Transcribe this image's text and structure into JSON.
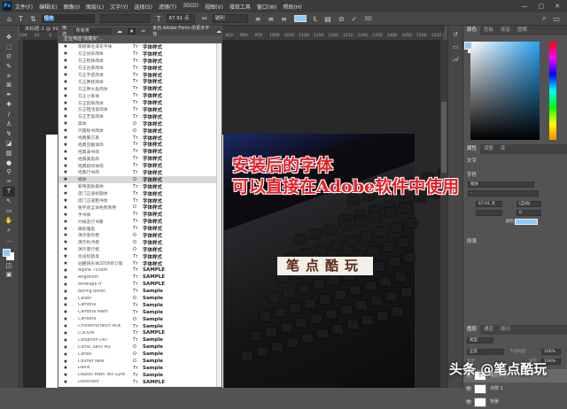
{
  "app": {
    "logo": "Ps",
    "menu": [
      "文件(F)",
      "编辑(E)",
      "图像(I)",
      "图层(L)",
      "文字(Y)",
      "选择(S)",
      "滤镜(T)",
      "3D(D)",
      "视图(V)",
      "增效工具",
      "窗口(W)",
      "帮助(H)"
    ],
    "window_controls": [
      "—",
      "▢",
      "✕"
    ]
  },
  "options": {
    "font_family": "楷体",
    "font_style": "",
    "size": "67.91 点",
    "antialias_icon": "aa",
    "antialias": "锐利",
    "color": "#8ccbf7"
  },
  "document": {
    "tab": "未标题-1 @ 99.2% (笔点酷玩, RGB/8) *",
    "ruler": [
      "100",
      "50",
      "0",
      "",
      "",
      "",
      "",
      "",
      "",
      "",
      "",
      "",
      "750",
      "800",
      "850",
      "900",
      "950",
      "1000",
      "1050",
      "1100",
      "1150",
      "1200",
      "1250",
      "1300",
      "1350",
      "1400",
      "1450",
      "1500",
      "1550"
    ]
  },
  "font_dropdown": {
    "filter_label": "筛选:",
    "filter_value": "所有类",
    "more_label": "来自 Adobe Fonts 的更多字体:",
    "filtering_text": "正在筛选\"收藏夹\"...",
    "fonts": [
      {
        "name": "草檀斋毛泽东字体",
        "type": "Tт",
        "sample": "字体样式"
      },
      {
        "name": "方正仿宋简体",
        "type": "Tт",
        "sample": "字体样式"
      },
      {
        "name": "方正楷体简体",
        "type": "Tт",
        "sample": "字体样式"
      },
      {
        "name": "方正古隶简体",
        "type": "Tт",
        "sample": "字体样式"
      },
      {
        "name": "方正字迹简体",
        "type": "Tт",
        "sample": "字体样式"
      },
      {
        "name": "方正胖娃简体",
        "type": "Tт",
        "sample": "字体样式"
      },
      {
        "name": "方正胖头鱼简体",
        "type": "Tт",
        "sample": "字体样式"
      },
      {
        "name": "方正小篆体",
        "type": "Tт",
        "sample": "字体样式"
      },
      {
        "name": "方正剪纸简体",
        "type": "Tт",
        "sample": "字体样式"
      },
      {
        "name": "方正粗活意简体",
        "type": "Tт",
        "sample": "字体样式"
      },
      {
        "name": "方正艺黑简体",
        "type": "Tт",
        "sample": "字体样式"
      },
      {
        "name": "黑体",
        "type": "O",
        "sample": "字体样式"
      },
      {
        "name": "鸿雷板书简体",
        "type": "O",
        "sample": "字体样式"
      },
      {
        "name": "经典繁方篆",
        "type": "Tт",
        "sample": "字体样式"
      },
      {
        "name": "经典空趣体简",
        "type": "Tт",
        "sample": "字体样式"
      },
      {
        "name": "经典隶书简",
        "type": "Tт",
        "sample": "字体样式"
      },
      {
        "name": "经典美黑简",
        "type": "Tт",
        "sample": "字体样式"
      },
      {
        "name": "经典舒同体简",
        "type": "Tт",
        "sample": "字体样式"
      },
      {
        "name": "经典行书简",
        "type": "Tт",
        "sample": "字体样式"
      },
      {
        "name": "楷体",
        "type": "O",
        "sample": "字体样式",
        "selected": true
      },
      {
        "name": "新蒂黑板报体",
        "type": "Tт",
        "sample": "字体样式"
      },
      {
        "name": "庞门正道标题体",
        "type": "Tт",
        "sample": "字体样式"
      },
      {
        "name": "庞门正道粗书体",
        "type": "Tт",
        "sample": "字体样式"
      },
      {
        "name": "锐字真言体免费商用",
        "type": "O",
        "sample": "字体样式"
      },
      {
        "name": "手书体",
        "type": "Tт",
        "sample": "字体样式"
      },
      {
        "name": "叶根友行书繁",
        "type": "Tт",
        "sample": "字体样式"
      },
      {
        "name": "微软雅黑",
        "type": "Tт",
        "sample": "字体样式",
        "group": true
      },
      {
        "name": "演示春风楷",
        "type": "O",
        "sample": "字体样式"
      },
      {
        "name": "演示秋鸿楷",
        "type": "O",
        "sample": "字体样式"
      },
      {
        "name": "演示夏行楷",
        "type": "O",
        "sample": "字体样式"
      },
      {
        "name": "优设标题黑",
        "type": "Tт",
        "sample": "字体样式"
      },
      {
        "name": "站酷快乐体2016修订版",
        "type": "Tт",
        "sample": "字体样式"
      },
      {
        "name": "Alpine 7558M",
        "type": "Tт",
        "sample": "SAMPLE"
      },
      {
        "name": "Angstrom",
        "type": "Tт",
        "sample": "SAMPLE"
      },
      {
        "name": "Antelope H",
        "type": "Tт",
        "sample": "SAMPLE"
      },
      {
        "name": "Boring Boron",
        "type": "Tт",
        "sample": "Sample"
      },
      {
        "name": "Calibri",
        "type": "O",
        "sample": "Sample",
        "group": true
      },
      {
        "name": "Cambria",
        "type": "Tт",
        "sample": "Sample",
        "group": true
      },
      {
        "name": "Cambria Math",
        "type": "Tт",
        "sample": "Sample"
      },
      {
        "name": "Candara",
        "type": "O",
        "sample": "Sample",
        "group": true
      },
      {
        "name": "ChickenScratch AOE",
        "type": "Tт",
        "sample": "Sample"
      },
      {
        "name": "CODON",
        "type": "Tт",
        "sample": "SAMPLE"
      },
      {
        "name": "Colophon DRT",
        "type": "Tт",
        "sample": "Sample"
      },
      {
        "name": "Comic Sans MS",
        "type": "O",
        "sample": "Sample",
        "group": true
      },
      {
        "name": "Corbel",
        "type": "O",
        "sample": "Sample",
        "group": true
      },
      {
        "name": "Courier New",
        "type": "O",
        "sample": "Sample",
        "group": true
      },
      {
        "name": "Davis",
        "type": "Tт",
        "sample": "Sample"
      },
      {
        "name": "DejaVu Math TeX Gyre",
        "type": "Tт",
        "sample": "Sample"
      },
      {
        "name": "Dissonant",
        "type": "Tт",
        "sample": "SAMPLE"
      }
    ]
  },
  "canvas": {
    "overlay_line1": "安装后的字体",
    "overlay_line2": "可以直接在Adobe软件中使用",
    "brand_text": "笔点酷玩"
  },
  "right_panel": {
    "color_tabs": [
      "颜色",
      "色板",
      "渐变",
      "图案"
    ],
    "prop_tabs": [
      "属性",
      "调整",
      "库"
    ],
    "prop_title": "文字",
    "char_section": "字符",
    "char_font": "楷体",
    "char_style": "-",
    "char_size": "67.91 点",
    "char_leading": "(自动)",
    "char_tracking": "0",
    "color_label": "颜色:",
    "para_section": "段落",
    "layer_tabs": [
      "图层",
      "通道",
      "路径"
    ],
    "layer_filter": "类型",
    "blend_mode": "正常",
    "opacity_label": "不透明度:",
    "opacity": "100%",
    "lock_label": "锁定:",
    "fill_label": "填充:",
    "fill": "100%",
    "layers": [
      {
        "name": "笔点酷玩",
        "thumb": "T"
      },
      {
        "name": "点阵 1",
        "thumb": ""
      },
      {
        "name": "背景",
        "thumb": ""
      }
    ]
  },
  "watermark": "头条 @笔点酷玩"
}
